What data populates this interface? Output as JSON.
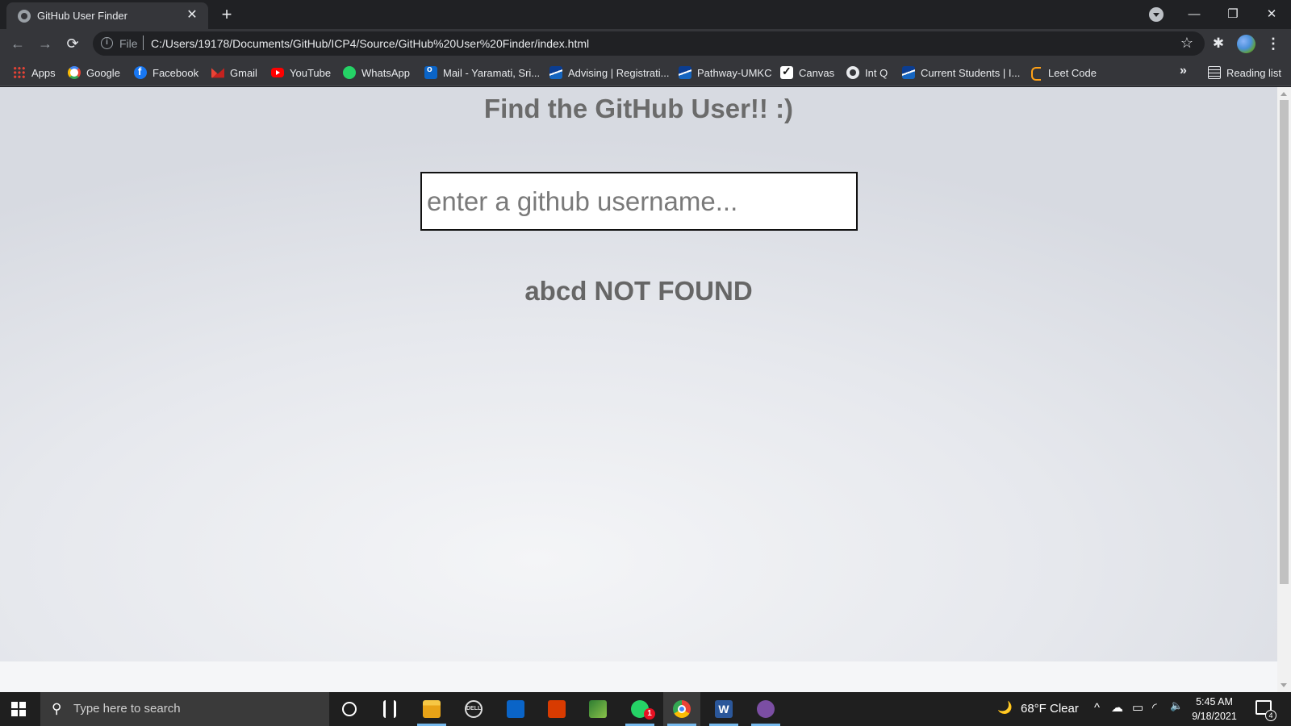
{
  "browser": {
    "tab": {
      "title": "GitHub User Finder",
      "close_glyph": "✕"
    },
    "new_tab_glyph": "+",
    "window_controls": {
      "minimize": "—",
      "restore": "❐",
      "close": "✕"
    },
    "toolbar": {
      "back_glyph": "←",
      "forward_glyph": "→",
      "reload_glyph": "⟳",
      "scheme_label": "File",
      "url": "C:/Users/19178/Documents/GitHub/ICP4/Source/GitHub%20User%20Finder/index.html",
      "star_glyph": "☆",
      "extensions_glyph": "✱",
      "menu_glyph": "⋮"
    },
    "bookmarks": [
      {
        "label": "Apps",
        "icon": "apps-grid-icon"
      },
      {
        "label": "Google",
        "icon": "google-icon"
      },
      {
        "label": "Facebook",
        "icon": "facebook-icon"
      },
      {
        "label": "Gmail",
        "icon": "gmail-icon"
      },
      {
        "label": "YouTube",
        "icon": "youtube-icon"
      },
      {
        "label": "WhatsApp",
        "icon": "whatsapp-icon"
      },
      {
        "label": "Mail - Yaramati, Sri...",
        "icon": "outlook-icon"
      },
      {
        "label": "Advising | Registrati...",
        "icon": "umkc-icon"
      },
      {
        "label": "Pathway-UMKC",
        "icon": "umkc-icon"
      },
      {
        "label": "Canvas",
        "icon": "canvas-icon"
      },
      {
        "label": "Int Q",
        "icon": "github-icon"
      },
      {
        "label": "Current Students | I...",
        "icon": "umkc-icon"
      },
      {
        "label": "Leet Code",
        "icon": "leetcode-icon"
      }
    ],
    "bookmarks_overflow_glyph": "»",
    "reading_list_label": "Reading list"
  },
  "page": {
    "heading": "Find the GitHub User!! :)",
    "search": {
      "placeholder": "enter a github username...",
      "value": ""
    },
    "result_message": "abcd NOT FOUND"
  },
  "taskbar": {
    "search_placeholder": "Type here to search",
    "search_glyph": "⚲",
    "apps": [
      {
        "name": "cortana",
        "running": false
      },
      {
        "name": "task-view",
        "running": false
      },
      {
        "name": "file-explorer",
        "running": true
      },
      {
        "name": "dell",
        "running": false
      },
      {
        "name": "outlook",
        "running": false
      },
      {
        "name": "office",
        "running": false
      },
      {
        "name": "green-app",
        "running": false
      },
      {
        "name": "whatsapp",
        "running": true,
        "badge": "1"
      },
      {
        "name": "chrome",
        "running": true,
        "focused": true
      },
      {
        "name": "word",
        "running": true,
        "label": "W"
      },
      {
        "name": "github-desktop",
        "running": true
      }
    ],
    "weather": {
      "icon": "moon-icon",
      "glyph": "🌙",
      "text": "68°F  Clear"
    },
    "tray_glyphs": {
      "chevron": "^",
      "cloud": "☁",
      "battery": "▭",
      "wifi": "◜",
      "volume": "🔈"
    },
    "clock": {
      "time": "5:45 AM",
      "date": "9/18/2021"
    },
    "notifications_count": "4"
  }
}
